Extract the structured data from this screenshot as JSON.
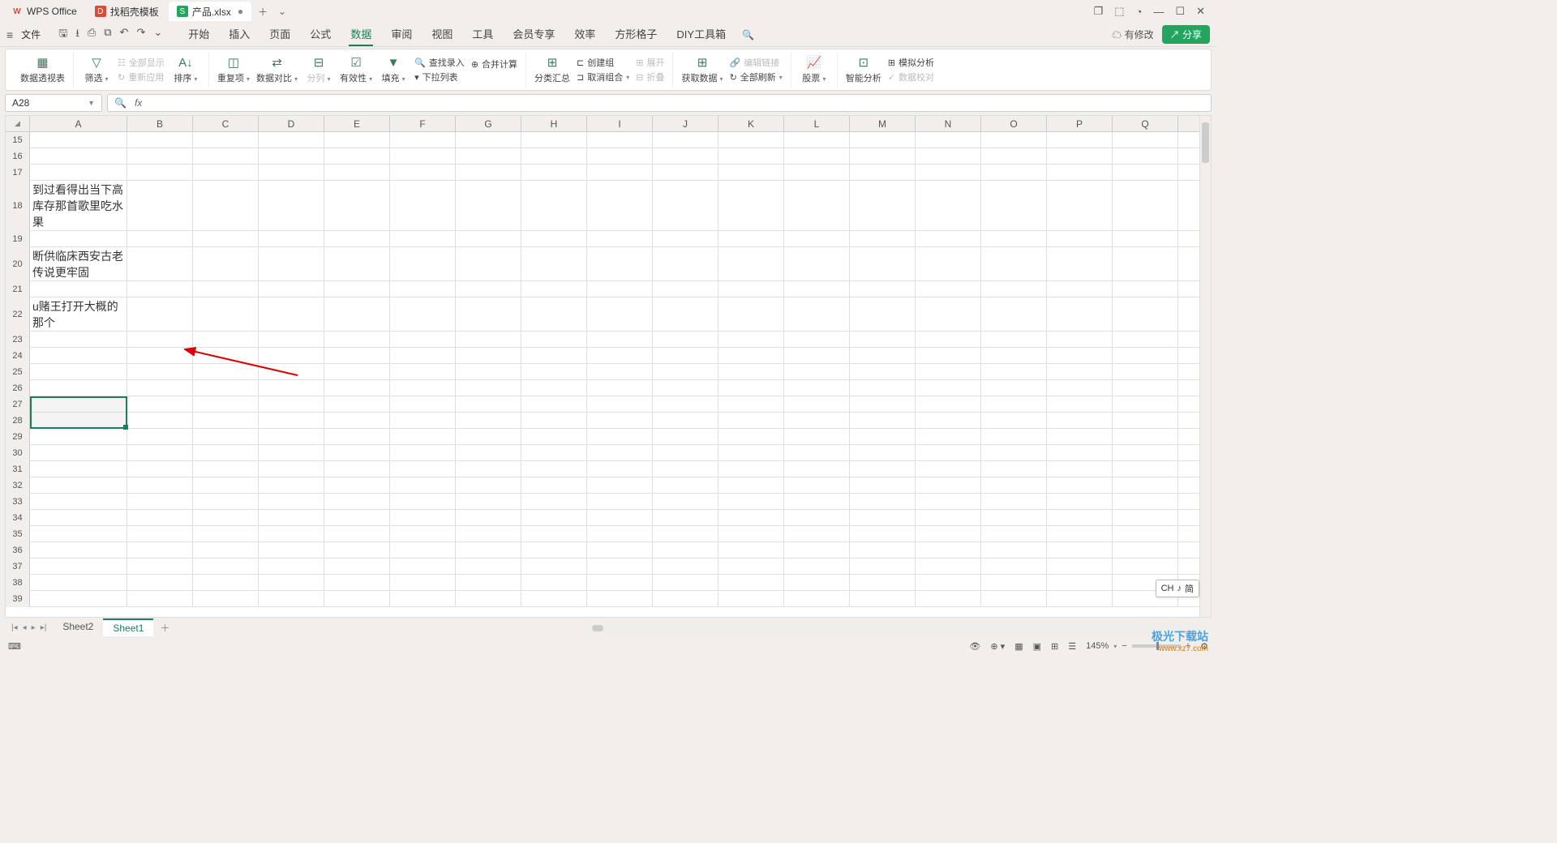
{
  "titlebar": {
    "app_tab": "WPS Office",
    "tabs": [
      {
        "icon_bg": "#d94b3a",
        "icon_letter": "D",
        "label": "找稻壳模板"
      },
      {
        "icon_bg": "#22a55f",
        "icon_letter": "S",
        "label": "产品.xlsx",
        "modified": true
      }
    ],
    "right_icons": {
      "restore": "❐",
      "cube": "⬚",
      "avatar": "◔",
      "min": "—",
      "max": "☐",
      "close": "✕"
    }
  },
  "menubar": {
    "file": "文件",
    "qa": {
      "save": "🖫",
      "export": "⭳",
      "print": "⎙",
      "preview": "⧉",
      "undo": "↶",
      "redo": "↷",
      "more": "⌄"
    },
    "tabs": [
      "开始",
      "插入",
      "页面",
      "公式",
      "数据",
      "审阅",
      "视图",
      "工具",
      "会员专享",
      "效率",
      "方形格子",
      "DIY工具箱"
    ],
    "active_index": 4,
    "search_icon": "🔍",
    "cloud": "有修改",
    "share": "分享"
  },
  "ribbon": {
    "pivot": "数据透视表",
    "filter": "筛选",
    "showall": "全部显示",
    "reapply": "重新应用",
    "sort": "排序",
    "dup": "重复项",
    "compare": "数据对比",
    "split": "分列",
    "validate": "有效性",
    "fill": "填充",
    "lookup": "查找录入",
    "consol": "合并计算",
    "dropdown": "下拉列表",
    "subtotal": "分类汇总",
    "ungroup": "取消组合",
    "group": "创建组",
    "expand": "展开",
    "collapse": "折叠",
    "getdata": "获取数据",
    "refresh": "全部刷新",
    "editlinks": "编辑链接",
    "stocks": "股票",
    "analysis": "智能分析",
    "whatif": "模拟分析",
    "dataval": "数据校对"
  },
  "namebox": "A28",
  "columns": [
    "A",
    "B",
    "C",
    "D",
    "E",
    "F",
    "G",
    "H",
    "I",
    "J",
    "K",
    "L",
    "M",
    "N",
    "O",
    "P",
    "Q"
  ],
  "rows": [
    {
      "n": 15,
      "h": "h20",
      "a": ""
    },
    {
      "n": 16,
      "h": "h20",
      "a": ""
    },
    {
      "n": 17,
      "h": "h20",
      "a": ""
    },
    {
      "n": 18,
      "h": "tall",
      "a": "到过看得出当下高库存那首歌里吃水果"
    },
    {
      "n": 19,
      "h": "h20",
      "a": ""
    },
    {
      "n": 20,
      "h": "med",
      "a": "断供临床西安古老传说更牢固"
    },
    {
      "n": 21,
      "h": "h20",
      "a": ""
    },
    {
      "n": 22,
      "h": "med",
      "a": "u赌王打开大概的那个"
    },
    {
      "n": 23,
      "h": "h20",
      "a": ""
    },
    {
      "n": 24,
      "h": "h20",
      "a": ""
    },
    {
      "n": 25,
      "h": "h20",
      "a": ""
    },
    {
      "n": 26,
      "h": "h20",
      "a": ""
    },
    {
      "n": 27,
      "h": "h20",
      "a": ""
    },
    {
      "n": 28,
      "h": "h20",
      "a": ""
    },
    {
      "n": 29,
      "h": "h20",
      "a": ""
    },
    {
      "n": 30,
      "h": "h20",
      "a": ""
    },
    {
      "n": 31,
      "h": "h20",
      "a": ""
    },
    {
      "n": 32,
      "h": "h20",
      "a": ""
    },
    {
      "n": 33,
      "h": "h20",
      "a": ""
    },
    {
      "n": 34,
      "h": "h20",
      "a": ""
    },
    {
      "n": 35,
      "h": "h20",
      "a": ""
    },
    {
      "n": 36,
      "h": "h20",
      "a": ""
    },
    {
      "n": 37,
      "h": "h20",
      "a": ""
    },
    {
      "n": 38,
      "h": "h20",
      "a": ""
    },
    {
      "n": 39,
      "h": "h20",
      "a": ""
    }
  ],
  "selection": {
    "range": "A27:A28"
  },
  "sheets": {
    "list": [
      "Sheet2",
      "Sheet1"
    ],
    "active_index": 1
  },
  "status": {
    "left_icon": "⌨",
    "eye": "👁",
    "target": "⊕",
    "views": {
      "normal": "▦",
      "page": "▣",
      "layout": "⊞",
      "outline": "☰"
    },
    "zoom": "145%",
    "minus": "−",
    "plus": "+"
  },
  "ime": {
    "lang": "CH",
    "mode": "♪",
    "style": "简"
  },
  "watermark": {
    "brand": "极光下载站",
    "url": "www.xz7.com"
  }
}
